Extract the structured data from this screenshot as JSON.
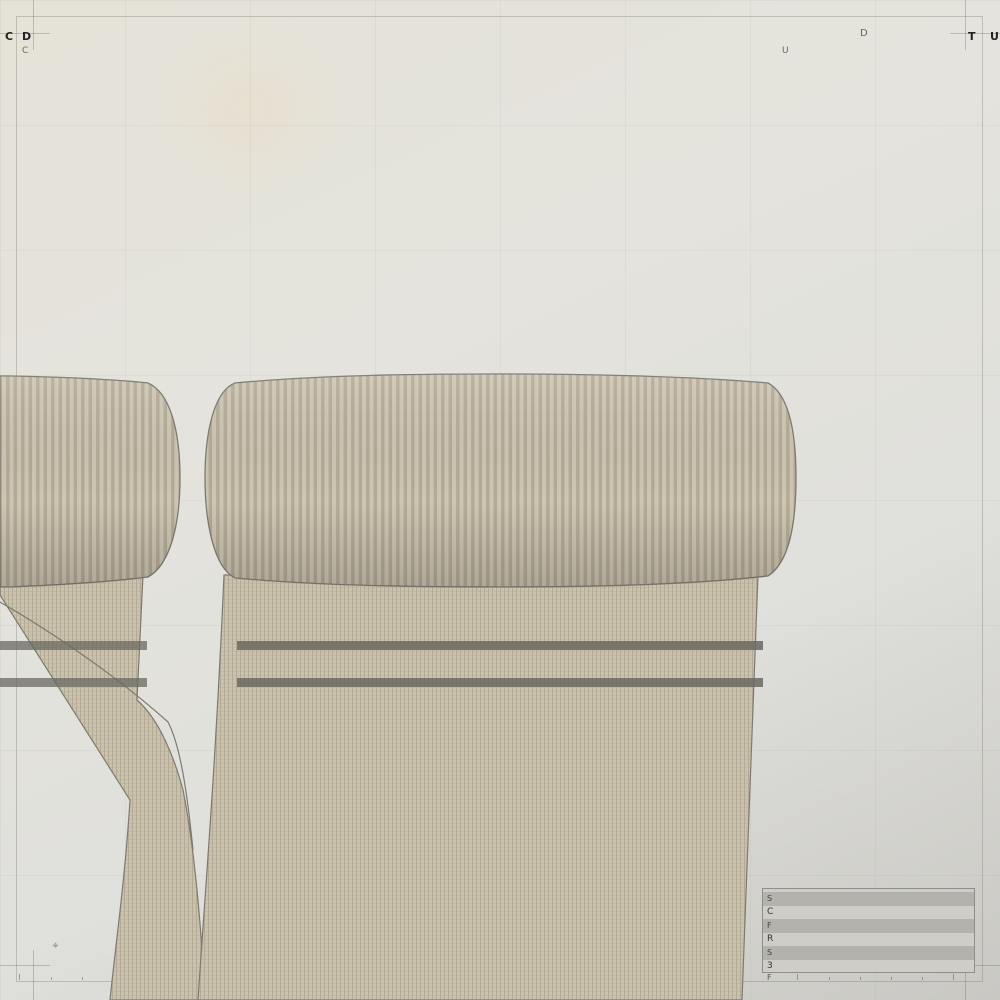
{
  "corners": {
    "top_left_primary": "C",
    "top_left_secondary": "D",
    "top_left_sub": "C",
    "top_right_mid_upper": "D",
    "top_right_mid_lower": "U",
    "top_right_primary": "T",
    "top_right_secondary": "U"
  },
  "legend": {
    "rows": [
      "S",
      "C",
      "F",
      "R",
      "S",
      "3",
      "F"
    ]
  },
  "colors": {
    "fabric": "#c8bfaa",
    "fabric_rib": "#9a927f",
    "band": "#6a6962",
    "outline": "#7e7a70"
  },
  "icons": {
    "registration_mark": "crosshair-icon"
  }
}
